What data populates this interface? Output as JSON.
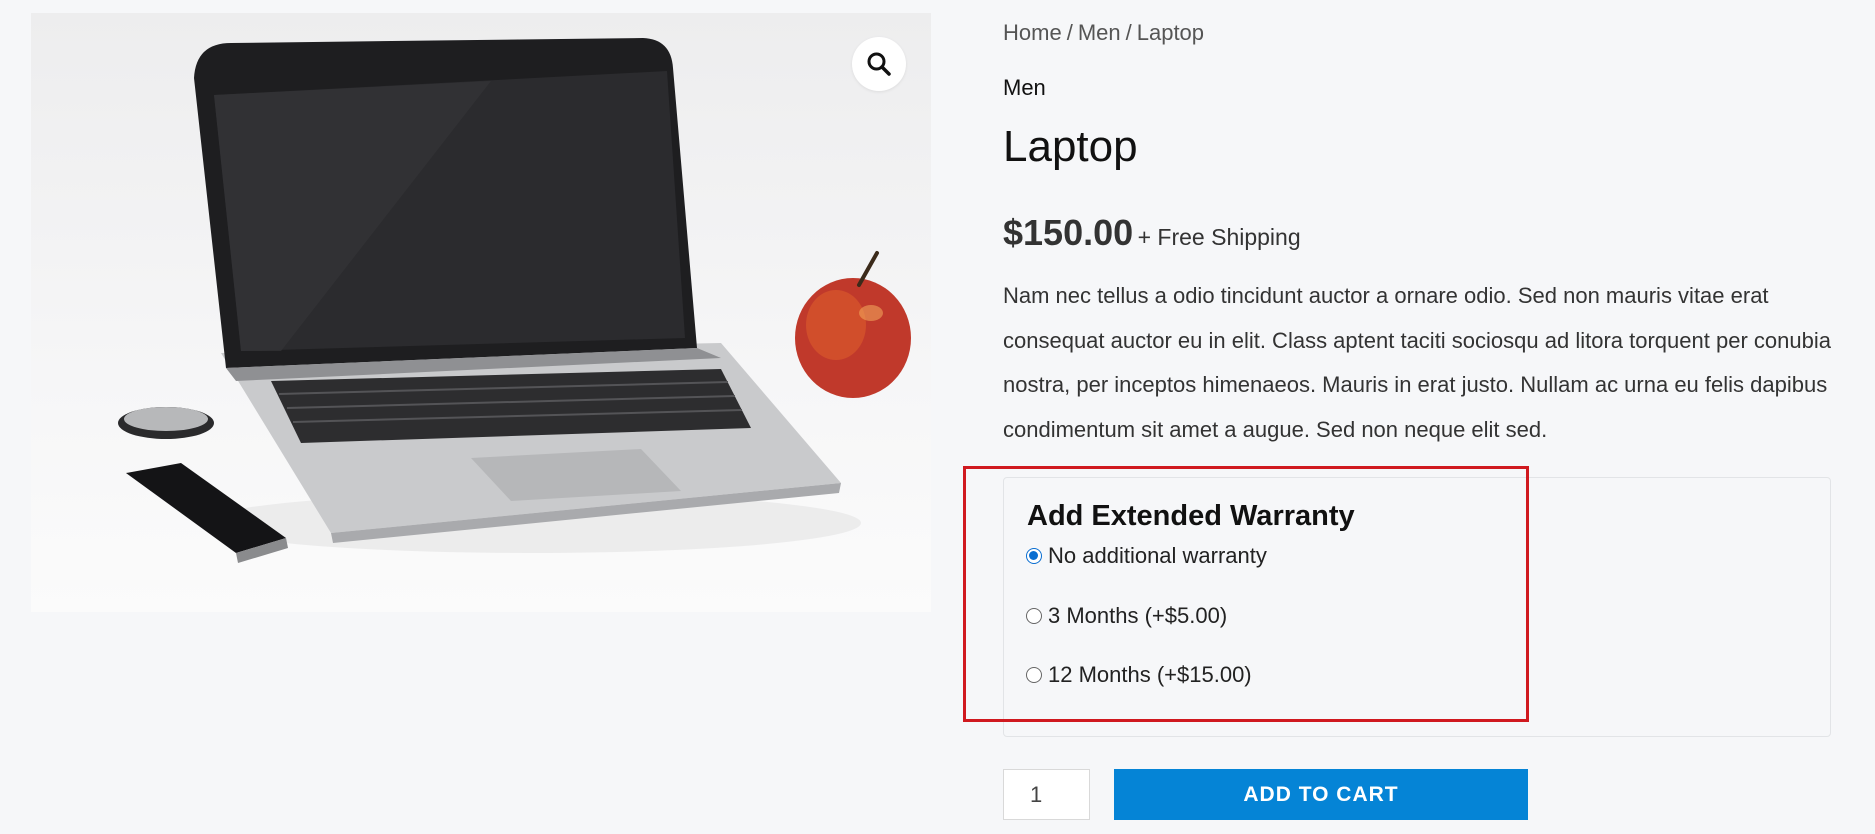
{
  "breadcrumb": {
    "items": [
      "Home",
      "Men",
      "Laptop"
    ],
    "separator": "/"
  },
  "product": {
    "category": "Men",
    "title": "Laptop",
    "price": "$150.00",
    "shipping": "+ Free Shipping",
    "description": "Nam nec tellus a odio tincidunt auctor a ornare odio. Sed non mauris vitae erat consequat auctor eu in elit. Class aptent taciti sociosqu ad litora torquent per conubia nostra, per inceptos himenaeos. Mauris in erat justo. Nullam ac urna eu felis dapibus condimentum sit amet a augue. Sed non neque elit sed.",
    "image_icon": "laptop-product-photo"
  },
  "gallery": {
    "zoom_icon": "magnifier-icon"
  },
  "warranty": {
    "title": "Add Extended Warranty",
    "options": [
      {
        "label": "No additional warranty",
        "checked": true
      },
      {
        "label": "3 Months (+$5.00)",
        "checked": false
      },
      {
        "label": "12 Months (+$15.00)",
        "checked": false
      }
    ]
  },
  "cart": {
    "quantity": "1",
    "add_to_cart_label": "ADD TO CART"
  },
  "colors": {
    "accent": "#0584d6",
    "highlight": "#d0191f",
    "radio_checked": "#0a6ed1"
  }
}
